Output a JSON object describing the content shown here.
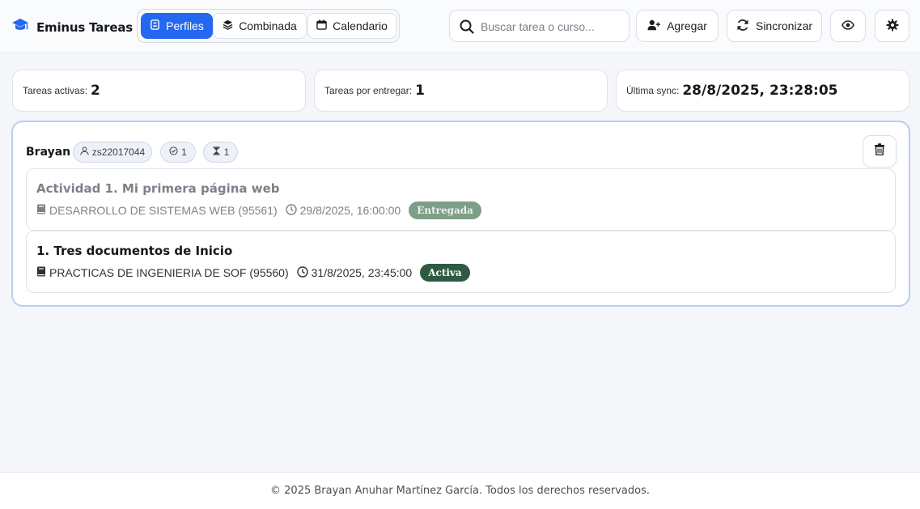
{
  "app": {
    "title": "Eminus Tareas",
    "accent_color": "#2468f2"
  },
  "views": {
    "perfiles": {
      "label": "Perfiles",
      "icon": "id-badge-icon",
      "active": true
    },
    "combinada": {
      "label": "Combinada",
      "icon": "layers-icon",
      "active": false
    },
    "calendario": {
      "label": "Calendario",
      "icon": "calendar-icon",
      "active": false
    }
  },
  "search": {
    "placeholder": "Buscar tarea o curso...",
    "value": ""
  },
  "actions": {
    "add_label": "Agregar",
    "sync_label": "Sincronizar",
    "visibility_icon": "eye-icon",
    "settings_icon": "gear-icon"
  },
  "stats": {
    "active": {
      "label": "Tareas activas:",
      "value": "2"
    },
    "due": {
      "label": "Tareas por entregar:",
      "value": "1"
    },
    "sync": {
      "label": "Última sync:",
      "value": "28/8/2025, 23:28:05"
    }
  },
  "profile": {
    "name": "Brayan",
    "user": "zs22017044",
    "completed": "1",
    "pending": "1",
    "tasks": [
      {
        "title": "Actividad 1. Mi primera página web",
        "course": "DESARROLLO DE SISTEMAS WEB (95561)",
        "due": "29/8/2025, 16:00:00",
        "status": "Entregada",
        "status_color": "#7f9e88"
      },
      {
        "title": "1. Tres documentos de Inicio",
        "course": "PRACTICAS DE INGENIERIA DE SOF (95560)",
        "due": "31/8/2025, 23:45:00",
        "status": "Activa",
        "status_color": "#2f5a41"
      }
    ]
  },
  "footer": {
    "text": "© 2025 Brayan Anuhar Martínez García. Todos los derechos reservados."
  }
}
